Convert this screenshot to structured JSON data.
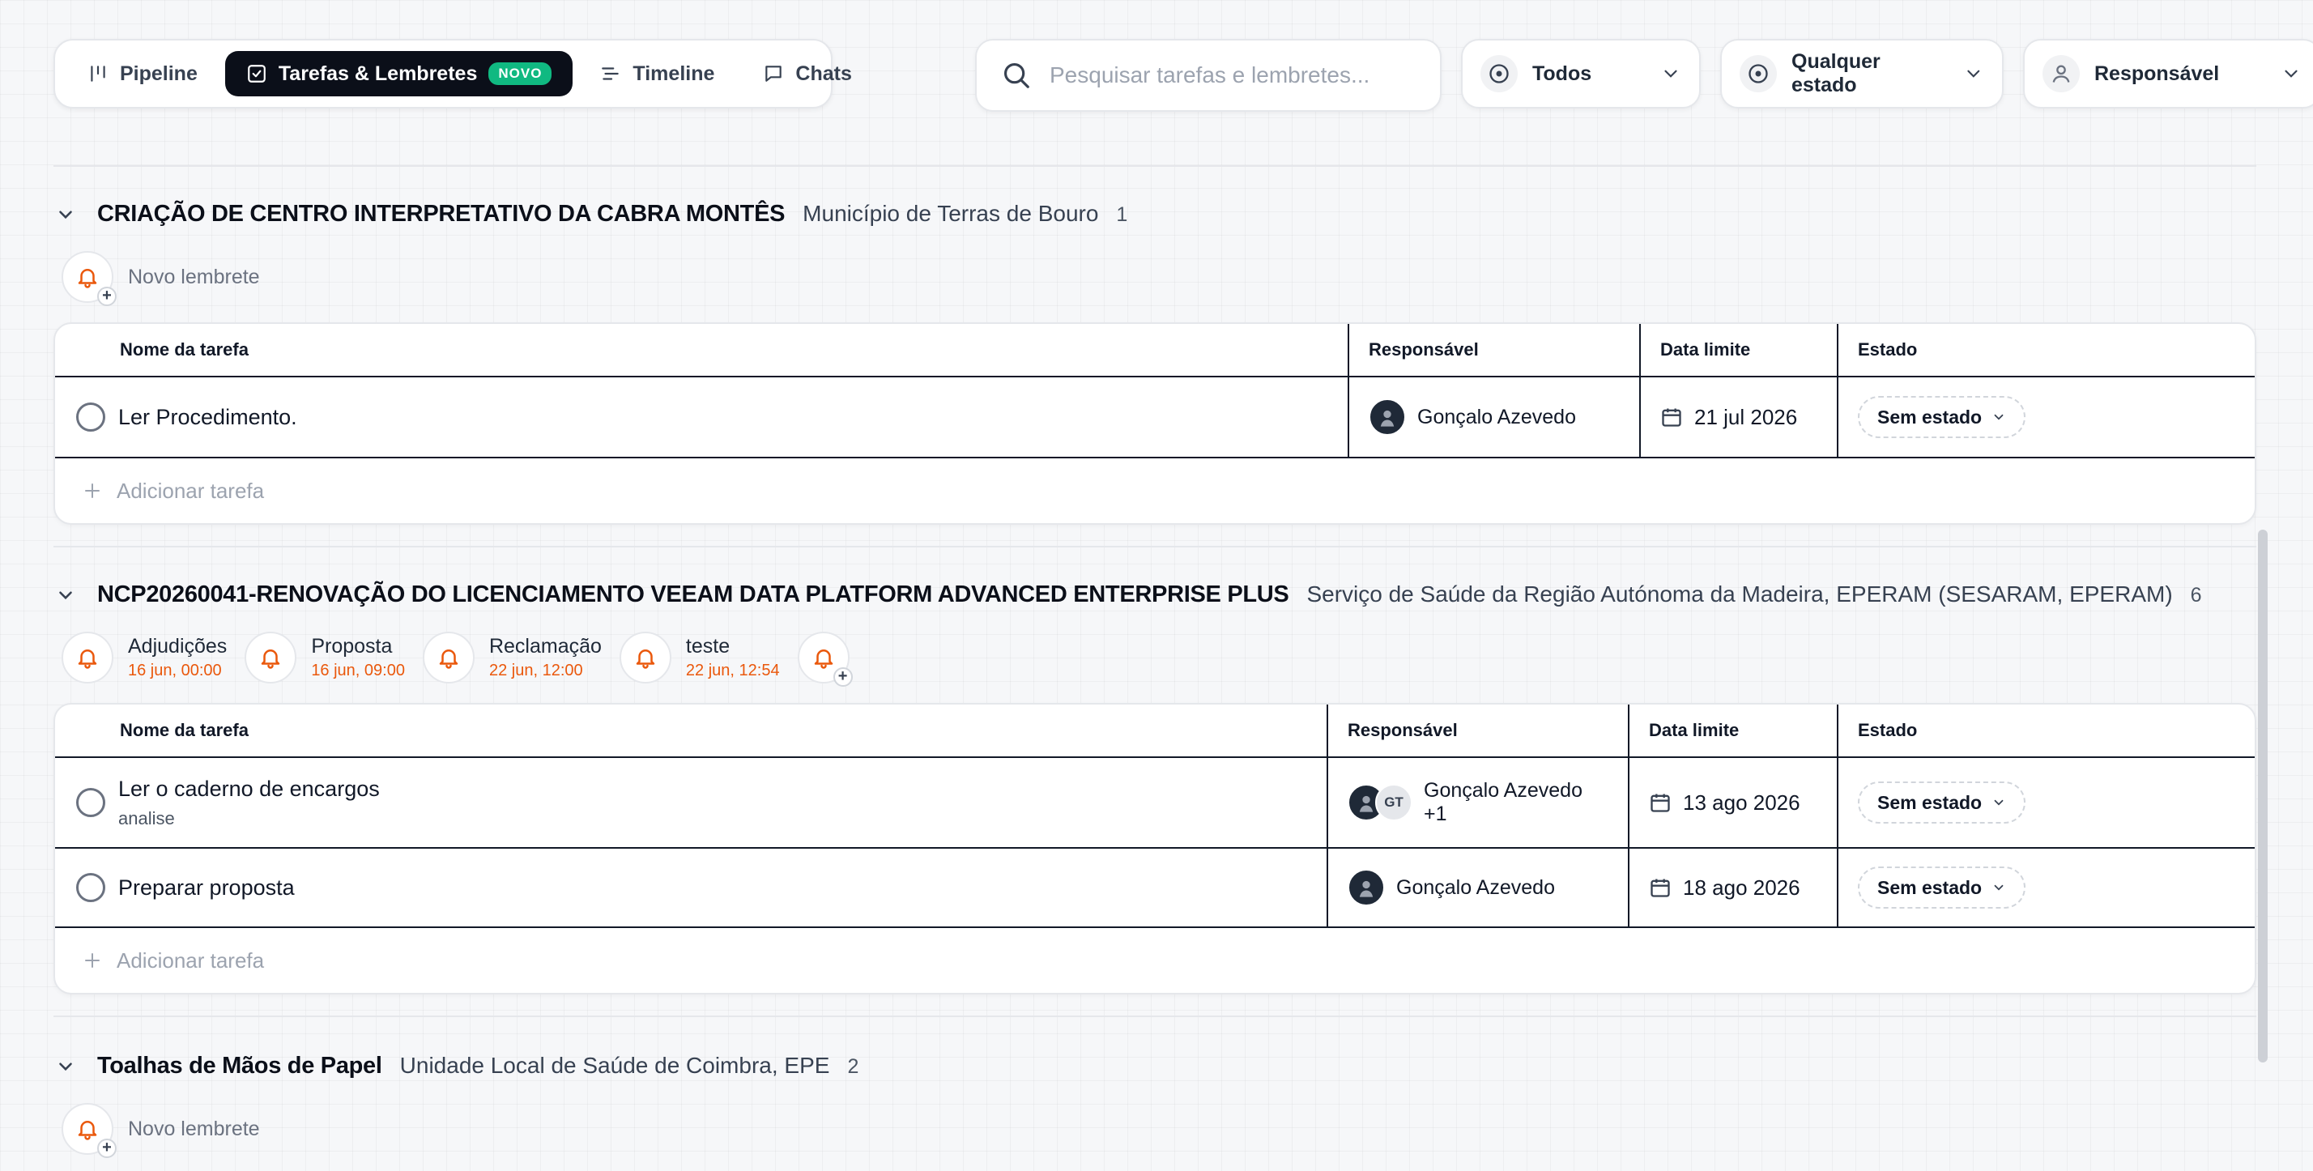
{
  "tabs": [
    {
      "label": "Pipeline",
      "icon": "pipeline-icon"
    },
    {
      "label": "Tarefas & Lembretes",
      "icon": "checkbox-icon",
      "badge": "NOVO",
      "active": true
    },
    {
      "label": "Timeline",
      "icon": "timeline-icon"
    },
    {
      "label": "Chats",
      "icon": "chat-icon"
    }
  ],
  "search": {
    "placeholder": "Pesquisar tarefas e lembretes..."
  },
  "filters": {
    "type": "Todos",
    "state": "Qualquer estado",
    "owner": "Responsável"
  },
  "columns": {
    "name": "Nome da tarefa",
    "owner": "Responsável",
    "due": "Data limite",
    "state": "Estado"
  },
  "new_reminder_label": "Novo lembrete",
  "add_task_label": "Adicionar tarefa",
  "groups": [
    {
      "title": "CRIAÇÃO DE CENTRO INTERPRETATIVO DA CABRA MONTÊS",
      "org": "Município de Terras de Bouro",
      "count": "1",
      "reminders": [],
      "tasks": [
        {
          "name": "Ler Procedimento.",
          "owner": "Gonçalo Azevedo",
          "due": "21 jul 2026",
          "state": "Sem estado"
        }
      ]
    },
    {
      "title": "NCP20260041-RENOVAÇÃO DO LICENCIAMENTO VEEAM DATA PLATFORM ADVANCED ENTERPRISE PLUS",
      "org": "Serviço de Saúde da Região Autónoma da Madeira, EPERAM (SESARAM, EPERAM)",
      "count": "6",
      "reminders": [
        {
          "name": "Adjudições",
          "date": "16 jun, 00:00"
        },
        {
          "name": "Proposta",
          "date": "16 jun, 09:00"
        },
        {
          "name": "Reclamação",
          "date": "22 jun, 12:00"
        },
        {
          "name": "teste",
          "date": "22 jun, 12:54"
        }
      ],
      "tasks": [
        {
          "name": "Ler o caderno de encargos",
          "sub": "analise",
          "owner": "Gonçalo Azevedo +1",
          "owner_initials": "GT",
          "due": "13 ago 2026",
          "state": "Sem estado"
        },
        {
          "name": "Preparar proposta",
          "owner": "Gonçalo Azevedo",
          "due": "18 ago 2026",
          "state": "Sem estado"
        }
      ]
    },
    {
      "title": "Toalhas de Mãos de Papel",
      "org": "Unidade Local de Saúde de Coimbra, EPE",
      "count": "2"
    }
  ],
  "colors": {
    "active_tab": "#0b0f19",
    "badge": "#10b981",
    "bell": "#ea580c",
    "reminder_date": "#ea580c"
  }
}
